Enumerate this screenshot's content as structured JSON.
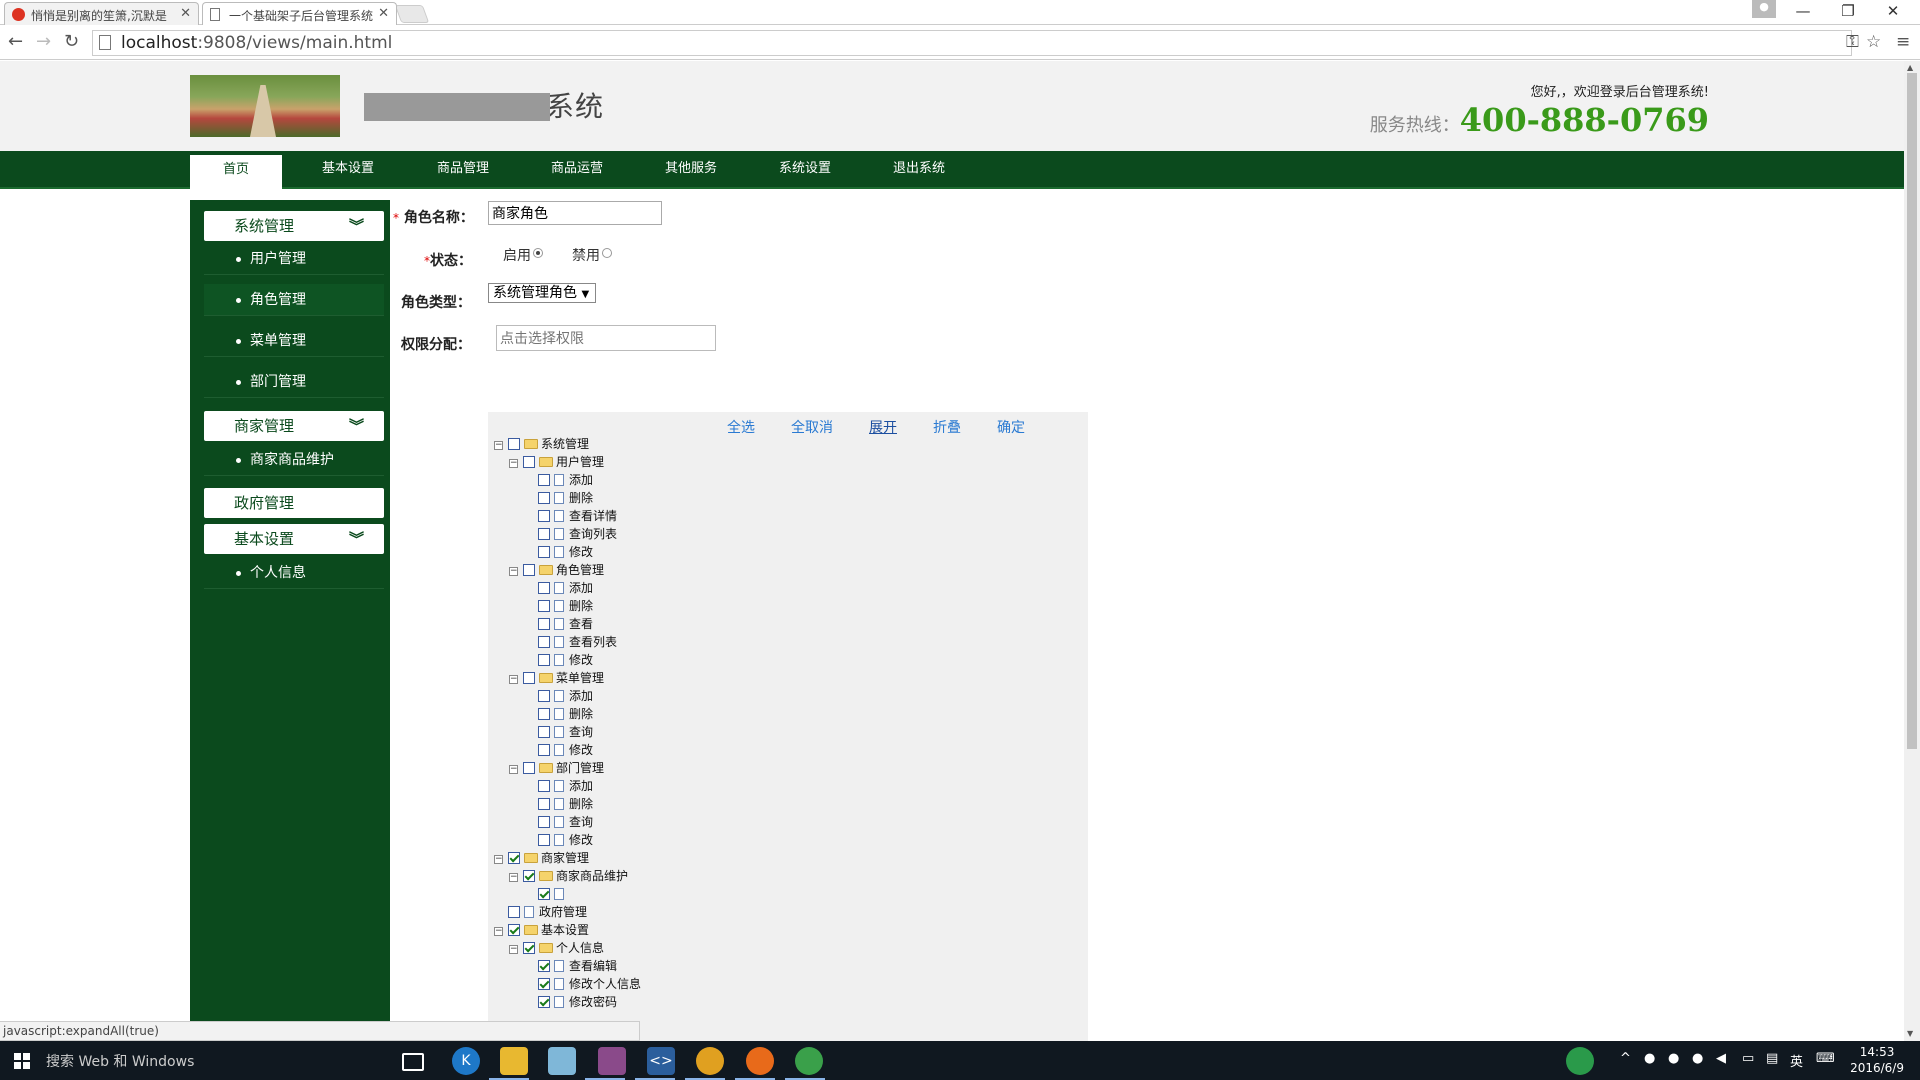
{
  "browser": {
    "tabs": [
      {
        "title": "悄悄是别离的笙箫,沉默是",
        "active": false
      },
      {
        "title": "一个基础架子后台管理系统",
        "active": true
      }
    ],
    "url_host": "localhost",
    "url_path": ":9808/views/main.html",
    "status_text": "javascript:expandAll(true)"
  },
  "header": {
    "site_name_visible": "系统",
    "welcome": "您好,，欢迎登录后台管理系统!",
    "hotline_label": "服务热线：",
    "hotline_number": "400-888-0769"
  },
  "mainnav": {
    "items": [
      "首页",
      "基本设置",
      "商品管理",
      "商品运营",
      "其他服务",
      "系统设置",
      "退出系统"
    ],
    "active_index": 0
  },
  "sidebar": {
    "groups": [
      {
        "label": "系统管理",
        "items": [
          "用户管理",
          "角色管理",
          "菜单管理",
          "部门管理"
        ]
      },
      {
        "label": "商家管理",
        "items": [
          "商家商品维护"
        ]
      },
      {
        "label": "政府管理",
        "items": []
      },
      {
        "label": "基本设置",
        "items": [
          "个人信息"
        ]
      }
    ],
    "active_item": "角色管理"
  },
  "form": {
    "role_name_label": "角色名称：",
    "role_name_value": "商家角色",
    "status_label": "状态：",
    "status_enabled": "启用",
    "status_disabled": "禁用",
    "status_value": "启用",
    "role_type_label": "角色类型：",
    "role_type_value": "系统管理角色",
    "perm_label": "权限分配：",
    "perm_placeholder": "点击选择权限",
    "required_mark": "*"
  },
  "perm_toolbar": {
    "select_all": "全选",
    "deselect_all": "全取消",
    "expand": "展开",
    "collapse": "折叠",
    "confirm": "确定"
  },
  "tree": [
    {
      "label": "系统管理",
      "level": 0,
      "type": "folder",
      "checked": false,
      "toggle": true
    },
    {
      "label": "用户管理",
      "level": 1,
      "type": "folder",
      "checked": false,
      "toggle": true
    },
    {
      "label": "添加",
      "level": 2,
      "type": "file",
      "checked": false
    },
    {
      "label": "删除",
      "level": 2,
      "type": "file",
      "checked": false
    },
    {
      "label": "查看详情",
      "level": 2,
      "type": "file",
      "checked": false
    },
    {
      "label": "查询列表",
      "level": 2,
      "type": "file",
      "checked": false
    },
    {
      "label": "修改",
      "level": 2,
      "type": "file",
      "checked": false
    },
    {
      "label": "角色管理",
      "level": 1,
      "type": "folder",
      "checked": false,
      "toggle": true
    },
    {
      "label": "添加",
      "level": 2,
      "type": "file",
      "checked": false
    },
    {
      "label": "删除",
      "level": 2,
      "type": "file",
      "checked": false
    },
    {
      "label": "查看",
      "level": 2,
      "type": "file",
      "checked": false
    },
    {
      "label": "查看列表",
      "level": 2,
      "type": "file",
      "checked": false
    },
    {
      "label": "修改",
      "level": 2,
      "type": "file",
      "checked": false
    },
    {
      "label": "菜单管理",
      "level": 1,
      "type": "folder",
      "checked": false,
      "toggle": true
    },
    {
      "label": "添加",
      "level": 2,
      "type": "file",
      "checked": false
    },
    {
      "label": "删除",
      "level": 2,
      "type": "file",
      "checked": false
    },
    {
      "label": "查询",
      "level": 2,
      "type": "file",
      "checked": false
    },
    {
      "label": "修改",
      "level": 2,
      "type": "file",
      "checked": false
    },
    {
      "label": "部门管理",
      "level": 1,
      "type": "folder",
      "checked": false,
      "toggle": true
    },
    {
      "label": "添加",
      "level": 2,
      "type": "file",
      "checked": false
    },
    {
      "label": "删除",
      "level": 2,
      "type": "file",
      "checked": false
    },
    {
      "label": "查询",
      "level": 2,
      "type": "file",
      "checked": false
    },
    {
      "label": "修改",
      "level": 2,
      "type": "file",
      "checked": false
    },
    {
      "label": "商家管理",
      "level": 0,
      "type": "folder",
      "checked": true,
      "toggle": true
    },
    {
      "label": "商家商品维护",
      "level": 1,
      "type": "folder",
      "checked": true,
      "toggle": true
    },
    {
      "label": "",
      "level": 2,
      "type": "file",
      "checked": true
    },
    {
      "label": "政府管理",
      "level": 0,
      "type": "file",
      "checked": false,
      "toggle": false
    },
    {
      "label": "基本设置",
      "level": 0,
      "type": "folder",
      "checked": true,
      "toggle": true
    },
    {
      "label": "个人信息",
      "level": 1,
      "type": "folder",
      "checked": true,
      "toggle": true
    },
    {
      "label": "查看编辑",
      "level": 2,
      "type": "file",
      "checked": true
    },
    {
      "label": "修改个人信息",
      "level": 2,
      "type": "file",
      "checked": true
    },
    {
      "label": "修改密码",
      "level": 2,
      "type": "file",
      "checked": true
    }
  ],
  "taskbar": {
    "search_text": "搜索 Web 和 Windows",
    "ime": "英",
    "time": "14:53",
    "date": "2016/6/9"
  },
  "colors": {
    "nav_green": "#0b4a1d",
    "hotline_green": "#3a9a1a",
    "link_blue": "#2a7ad2"
  }
}
